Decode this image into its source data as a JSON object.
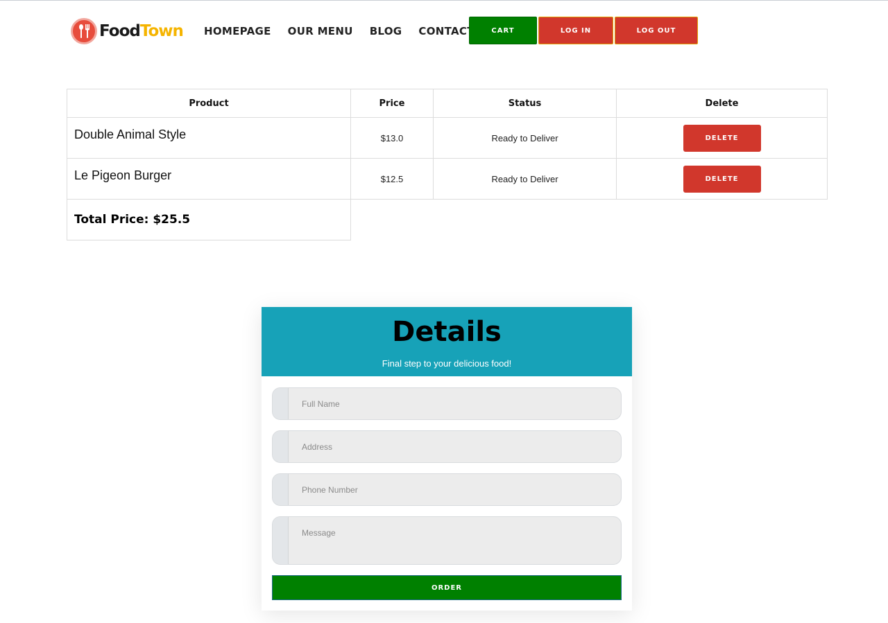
{
  "brand": {
    "name_part1": "Food",
    "name_part2": "Town",
    "icon": "fork-spoon-icon"
  },
  "nav": {
    "items": [
      {
        "label": "HOMEPAGE"
      },
      {
        "label": "OUR MENU"
      },
      {
        "label": "BLOG"
      },
      {
        "label": "CONTACT US"
      }
    ],
    "cart_label": "CART",
    "login_label": "LOG IN",
    "logout_label": "LOG OUT"
  },
  "cart": {
    "headers": {
      "product": "Product",
      "price": "Price",
      "status": "Status",
      "delete": "Delete"
    },
    "rows": [
      {
        "product": "Double Animal Style",
        "price": "$13.0",
        "status": "Ready to Deliver",
        "delete_label": "DELETE"
      },
      {
        "product": "Le Pigeon Burger",
        "price": "$12.5",
        "status": "Ready to Deliver",
        "delete_label": "DELETE"
      }
    ],
    "total": "Total Price: $25.5"
  },
  "details": {
    "title": "Details",
    "subtitle": "Final step to your delicious food!",
    "fields": {
      "full_name": {
        "placeholder": "Full Name",
        "value": ""
      },
      "address": {
        "placeholder": "Address",
        "value": ""
      },
      "phone": {
        "placeholder": "Phone Number",
        "value": ""
      },
      "message": {
        "placeholder": "Message",
        "value": ""
      }
    },
    "order_label": "ORDER"
  },
  "colors": {
    "cart_button": "#008000",
    "login_button": "#d1372c",
    "logout_button": "#d1372c",
    "delete_button": "#d1372c",
    "details_header": "#17a2b8",
    "order_button": "#008000",
    "brand_accent": "#f5b400"
  }
}
